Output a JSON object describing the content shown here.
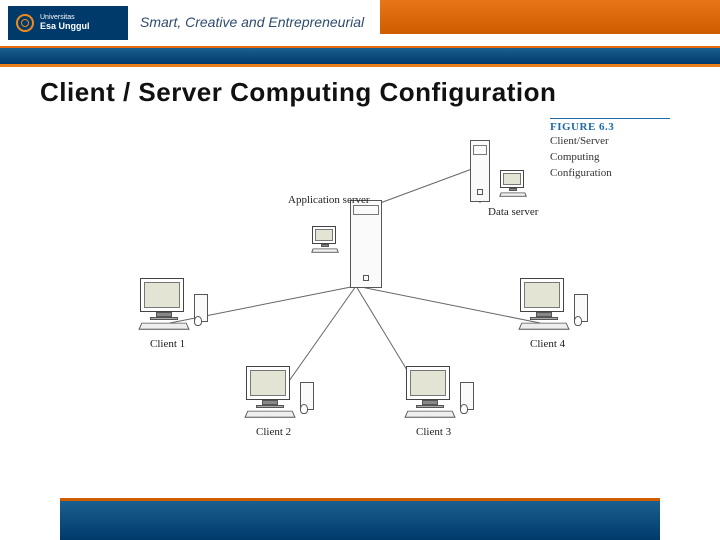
{
  "header": {
    "brand_top": "Universitas",
    "brand": "Esa Unggul",
    "tagline": "Smart, Creative and Entrepreneurial"
  },
  "slide": {
    "title": "Client / Server Computing Configuration"
  },
  "figure": {
    "number": "FIGURE 6.3",
    "title_l1": "Client/Server",
    "title_l2": "Computing",
    "title_l3": "Configuration"
  },
  "labels": {
    "app_server": "Application server",
    "data_server": "Data server",
    "client1": "Client 1",
    "client2": "Client 2",
    "client3": "Client 3",
    "client4": "Client 4"
  }
}
